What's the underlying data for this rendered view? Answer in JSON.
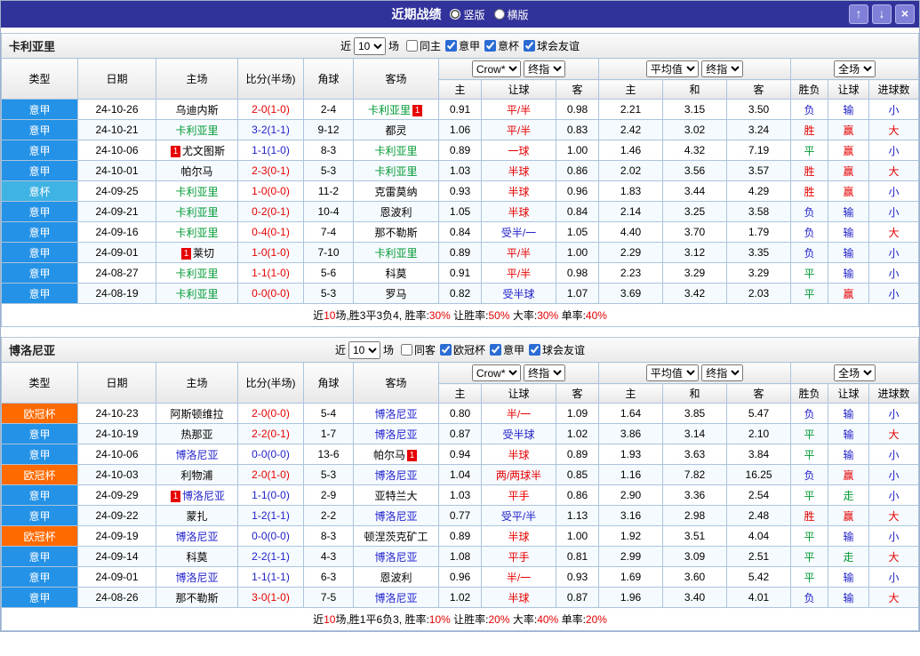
{
  "titlebar": {
    "title": "近期战绩",
    "view_options": [
      {
        "label": "竖版",
        "selected": true
      },
      {
        "label": "横版",
        "selected": false
      }
    ],
    "buttons": {
      "up": "↑",
      "down": "↓",
      "close": "×"
    }
  },
  "colors": {
    "red": "#E60000",
    "blue": "#2020C8",
    "green": "#009933",
    "black": "#000000",
    "cagliari": "#009933",
    "bologna": "#2323CC",
    "serie_a": "#2492E6",
    "coppa_italia": "#3FB3E3",
    "ucl": "#FF6A00",
    "titlebar_bg": "#32329B",
    "button_bg": "#8080D8",
    "badge_bg": "#E60000"
  },
  "table_header": {
    "base": [
      "类型",
      "日期",
      "主场",
      "比分(半场)",
      "角球",
      "客场"
    ],
    "odds_selects": [
      "Crow*",
      "终指"
    ],
    "odds_cols": [
      "主",
      "让球",
      "客"
    ],
    "avg_selects": [
      "平均值",
      "终指"
    ],
    "avg_cols": [
      "主",
      "和",
      "客"
    ],
    "full_select": "全场",
    "result_cols": [
      "胜负",
      "让球",
      "进球数"
    ]
  },
  "sections": [
    {
      "team": "卡利亚里",
      "filter": {
        "prefix": "近",
        "count": "10",
        "suffix": "场",
        "checkboxes": [
          {
            "label": "同主",
            "checked": false
          },
          {
            "label": "意甲",
            "checked": true
          },
          {
            "label": "意杯",
            "checked": true
          },
          {
            "label": "球会友谊",
            "checked": true
          }
        ]
      },
      "rows": [
        {
          "league": "意甲",
          "league_color": "serie_a",
          "date": "24-10-26",
          "home": {
            "name": "乌迪内斯",
            "color": "black"
          },
          "score": "2-0(1-0)",
          "score_color": "red",
          "corners": "2-4",
          "away": {
            "name": "卡利亚里",
            "color": "cagliari",
            "badge_after": "1"
          },
          "odds_home": "0.91",
          "handicap": "平/半",
          "handicap_color": "red",
          "odds_away": "0.98",
          "avg_home": "2.21",
          "avg_draw": "3.15",
          "avg_away": "3.50",
          "outcome": "负",
          "outcome_color": "blue",
          "handicap_result": "输",
          "handicap_result_color": "blue",
          "goals": "小",
          "goals_color": "blue"
        },
        {
          "league": "意甲",
          "league_color": "serie_a",
          "date": "24-10-21",
          "home": {
            "name": "卡利亚里",
            "color": "cagliari"
          },
          "score": "3-2(1-1)",
          "score_color": "blue",
          "corners": "9-12",
          "away": {
            "name": "都灵",
            "color": "black"
          },
          "odds_home": "1.06",
          "handicap": "平/半",
          "handicap_color": "red",
          "odds_away": "0.83",
          "avg_home": "2.42",
          "avg_draw": "3.02",
          "avg_away": "3.24",
          "outcome": "胜",
          "outcome_color": "red",
          "handicap_result": "赢",
          "handicap_result_color": "red",
          "goals": "大",
          "goals_color": "red"
        },
        {
          "league": "意甲",
          "league_color": "serie_a",
          "date": "24-10-06",
          "home": {
            "name": "尤文图斯",
            "color": "black",
            "badge_before": "1"
          },
          "score": "1-1(1-0)",
          "score_color": "blue",
          "corners": "8-3",
          "away": {
            "name": "卡利亚里",
            "color": "cagliari"
          },
          "odds_home": "0.89",
          "handicap": "一球",
          "handicap_color": "red",
          "odds_away": "1.00",
          "avg_home": "1.46",
          "avg_draw": "4.32",
          "avg_away": "7.19",
          "outcome": "平",
          "outcome_color": "green",
          "handicap_result": "赢",
          "handicap_result_color": "red",
          "goals": "小",
          "goals_color": "blue"
        },
        {
          "league": "意甲",
          "league_color": "serie_a",
          "date": "24-10-01",
          "home": {
            "name": "帕尔马",
            "color": "black"
          },
          "score": "2-3(0-1)",
          "score_color": "red",
          "corners": "5-3",
          "away": {
            "name": "卡利亚里",
            "color": "cagliari"
          },
          "odds_home": "1.03",
          "handicap": "半球",
          "handicap_color": "red",
          "odds_away": "0.86",
          "avg_home": "2.02",
          "avg_draw": "3.56",
          "avg_away": "3.57",
          "outcome": "胜",
          "outcome_color": "red",
          "handicap_result": "赢",
          "handicap_result_color": "red",
          "goals": "大",
          "goals_color": "red"
        },
        {
          "league": "意杯",
          "league_color": "coppa_italia",
          "date": "24-09-25",
          "home": {
            "name": "卡利亚里",
            "color": "cagliari"
          },
          "score": "1-0(0-0)",
          "score_color": "red",
          "corners": "11-2",
          "away": {
            "name": "克雷莫纳",
            "color": "black"
          },
          "odds_home": "0.93",
          "handicap": "半球",
          "handicap_color": "red",
          "odds_away": "0.96",
          "avg_home": "1.83",
          "avg_draw": "3.44",
          "avg_away": "4.29",
          "outcome": "胜",
          "outcome_color": "red",
          "handicap_result": "赢",
          "handicap_result_color": "red",
          "goals": "小",
          "goals_color": "blue"
        },
        {
          "league": "意甲",
          "league_color": "serie_a",
          "date": "24-09-21",
          "home": {
            "name": "卡利亚里",
            "color": "cagliari"
          },
          "score": "0-2(0-1)",
          "score_color": "red",
          "corners": "10-4",
          "away": {
            "name": "恩波利",
            "color": "black"
          },
          "odds_home": "1.05",
          "handicap": "半球",
          "handicap_color": "red",
          "odds_away": "0.84",
          "avg_home": "2.14",
          "avg_draw": "3.25",
          "avg_away": "3.58",
          "outcome": "负",
          "outcome_color": "blue",
          "handicap_result": "输",
          "handicap_result_color": "blue",
          "goals": "小",
          "goals_color": "blue"
        },
        {
          "league": "意甲",
          "league_color": "serie_a",
          "date": "24-09-16",
          "home": {
            "name": "卡利亚里",
            "color": "cagliari"
          },
          "score": "0-4(0-1)",
          "score_color": "red",
          "corners": "7-4",
          "away": {
            "name": "那不勒斯",
            "color": "black"
          },
          "odds_home": "0.84",
          "handicap": "受半/一",
          "handicap_color": "blue",
          "odds_away": "1.05",
          "avg_home": "4.40",
          "avg_draw": "3.70",
          "avg_away": "1.79",
          "outcome": "负",
          "outcome_color": "blue",
          "handicap_result": "输",
          "handicap_result_color": "blue",
          "goals": "大",
          "goals_color": "red"
        },
        {
          "league": "意甲",
          "league_color": "serie_a",
          "date": "24-09-01",
          "home": {
            "name": "莱切",
            "color": "black",
            "badge_before": "1"
          },
          "score": "1-0(1-0)",
          "score_color": "red",
          "corners": "7-10",
          "away": {
            "name": "卡利亚里",
            "color": "cagliari"
          },
          "odds_home": "0.89",
          "handicap": "平/半",
          "handicap_color": "red",
          "odds_away": "1.00",
          "avg_home": "2.29",
          "avg_draw": "3.12",
          "avg_away": "3.35",
          "outcome": "负",
          "outcome_color": "blue",
          "handicap_result": "输",
          "handicap_result_color": "blue",
          "goals": "小",
          "goals_color": "blue"
        },
        {
          "league": "意甲",
          "league_color": "serie_a",
          "date": "24-08-27",
          "home": {
            "name": "卡利亚里",
            "color": "cagliari"
          },
          "score": "1-1(1-0)",
          "score_color": "red",
          "corners": "5-6",
          "away": {
            "name": "科莫",
            "color": "black"
          },
          "odds_home": "0.91",
          "handicap": "平/半",
          "handicap_color": "red",
          "odds_away": "0.98",
          "avg_home": "2.23",
          "avg_draw": "3.29",
          "avg_away": "3.29",
          "outcome": "平",
          "outcome_color": "green",
          "handicap_result": "输",
          "handicap_result_color": "blue",
          "goals": "小",
          "goals_color": "blue"
        },
        {
          "league": "意甲",
          "league_color": "serie_a",
          "date": "24-08-19",
          "home": {
            "name": "卡利亚里",
            "color": "cagliari"
          },
          "score": "0-0(0-0)",
          "score_color": "red",
          "corners": "5-3",
          "away": {
            "name": "罗马",
            "color": "black"
          },
          "odds_home": "0.82",
          "handicap": "受半球",
          "handicap_color": "blue",
          "odds_away": "1.07",
          "avg_home": "3.69",
          "avg_draw": "3.42",
          "avg_away": "2.03",
          "outcome": "平",
          "outcome_color": "green",
          "handicap_result": "赢",
          "handicap_result_color": "red",
          "goals": "小",
          "goals_color": "blue"
        }
      ],
      "summary": [
        {
          "text": "近",
          "red": false
        },
        {
          "text": "10",
          "red": true
        },
        {
          "text": "场,胜3平3负4, 胜率:",
          "red": false
        },
        {
          "text": "30%",
          "red": true
        },
        {
          "text": " 让胜率:",
          "red": false
        },
        {
          "text": "50%",
          "red": true
        },
        {
          "text": " 大率:",
          "red": false
        },
        {
          "text": "30%",
          "red": true
        },
        {
          "text": " 单率:",
          "red": false
        },
        {
          "text": "40%",
          "red": true
        }
      ]
    },
    {
      "team": "博洛尼亚",
      "filter": {
        "prefix": "近",
        "count": "10",
        "suffix": "场",
        "checkboxes": [
          {
            "label": "同客",
            "checked": false
          },
          {
            "label": "欧冠杯",
            "checked": true
          },
          {
            "label": "意甲",
            "checked": true
          },
          {
            "label": "球会友谊",
            "checked": true
          }
        ]
      },
      "rows": [
        {
          "league": "欧冠杯",
          "league_color": "ucl",
          "date": "24-10-23",
          "home": {
            "name": "阿斯顿维拉",
            "color": "black"
          },
          "score": "2-0(0-0)",
          "score_color": "red",
          "corners": "5-4",
          "away": {
            "name": "博洛尼亚",
            "color": "bologna"
          },
          "odds_home": "0.80",
          "handicap": "半/一",
          "handicap_color": "red",
          "odds_away": "1.09",
          "avg_home": "1.64",
          "avg_draw": "3.85",
          "avg_away": "5.47",
          "outcome": "负",
          "outcome_color": "blue",
          "handicap_result": "输",
          "handicap_result_color": "blue",
          "goals": "小",
          "goals_color": "blue"
        },
        {
          "league": "意甲",
          "league_color": "serie_a",
          "date": "24-10-19",
          "home": {
            "name": "热那亚",
            "color": "black"
          },
          "score": "2-2(0-1)",
          "score_color": "red",
          "corners": "1-7",
          "away": {
            "name": "博洛尼亚",
            "color": "bologna"
          },
          "odds_home": "0.87",
          "handicap": "受半球",
          "handicap_color": "blue",
          "odds_away": "1.02",
          "avg_home": "3.86",
          "avg_draw": "3.14",
          "avg_away": "2.10",
          "outcome": "平",
          "outcome_color": "green",
          "handicap_result": "输",
          "handicap_result_color": "blue",
          "goals": "大",
          "goals_color": "red"
        },
        {
          "league": "意甲",
          "league_color": "serie_a",
          "date": "24-10-06",
          "home": {
            "name": "博洛尼亚",
            "color": "bologna"
          },
          "score": "0-0(0-0)",
          "score_color": "blue",
          "corners": "13-6",
          "away": {
            "name": "帕尔马",
            "color": "black",
            "badge_after": "1"
          },
          "odds_home": "0.94",
          "handicap": "半球",
          "handicap_color": "red",
          "odds_away": "0.89",
          "avg_home": "1.93",
          "avg_draw": "3.63",
          "avg_away": "3.84",
          "outcome": "平",
          "outcome_color": "green",
          "handicap_result": "输",
          "handicap_result_color": "blue",
          "goals": "小",
          "goals_color": "blue"
        },
        {
          "league": "欧冠杯",
          "league_color": "ucl",
          "date": "24-10-03",
          "home": {
            "name": "利物浦",
            "color": "black"
          },
          "score": "2-0(1-0)",
          "score_color": "red",
          "corners": "5-3",
          "away": {
            "name": "博洛尼亚",
            "color": "bologna"
          },
          "odds_home": "1.04",
          "handicap": "两/两球半",
          "handicap_color": "red",
          "odds_away": "0.85",
          "avg_home": "1.16",
          "avg_draw": "7.82",
          "avg_away": "16.25",
          "outcome": "负",
          "outcome_color": "blue",
          "handicap_result": "赢",
          "handicap_result_color": "red",
          "goals": "小",
          "goals_color": "blue"
        },
        {
          "league": "意甲",
          "league_color": "serie_a",
          "date": "24-09-29",
          "home": {
            "name": "博洛尼亚",
            "color": "bologna",
            "badge_before": "1"
          },
          "score": "1-1(0-0)",
          "score_color": "blue",
          "corners": "2-9",
          "away": {
            "name": "亚特兰大",
            "color": "black"
          },
          "odds_home": "1.03",
          "handicap": "平手",
          "handicap_color": "red",
          "odds_away": "0.86",
          "avg_home": "2.90",
          "avg_draw": "3.36",
          "avg_away": "2.54",
          "outcome": "平",
          "outcome_color": "green",
          "handicap_result": "走",
          "handicap_result_color": "green",
          "goals": "小",
          "goals_color": "blue"
        },
        {
          "league": "意甲",
          "league_color": "serie_a",
          "date": "24-09-22",
          "home": {
            "name": "蒙扎",
            "color": "black"
          },
          "score": "1-2(1-1)",
          "score_color": "blue",
          "corners": "2-2",
          "away": {
            "name": "博洛尼亚",
            "color": "bologna"
          },
          "odds_home": "0.77",
          "handicap": "受平/半",
          "handicap_color": "blue",
          "odds_away": "1.13",
          "avg_home": "3.16",
          "avg_draw": "2.98",
          "avg_away": "2.48",
          "outcome": "胜",
          "outcome_color": "red",
          "handicap_result": "赢",
          "handicap_result_color": "red",
          "goals": "大",
          "goals_color": "red"
        },
        {
          "league": "欧冠杯",
          "league_color": "ucl",
          "date": "24-09-19",
          "home": {
            "name": "博洛尼亚",
            "color": "bologna"
          },
          "score": "0-0(0-0)",
          "score_color": "blue",
          "corners": "8-3",
          "away": {
            "name": "顿涅茨克矿工",
            "color": "black"
          },
          "odds_home": "0.89",
          "handicap": "半球",
          "handicap_color": "red",
          "odds_away": "1.00",
          "avg_home": "1.92",
          "avg_draw": "3.51",
          "avg_away": "4.04",
          "outcome": "平",
          "outcome_color": "green",
          "handicap_result": "输",
          "handicap_result_color": "blue",
          "goals": "小",
          "goals_color": "blue"
        },
        {
          "league": "意甲",
          "league_color": "serie_a",
          "date": "24-09-14",
          "home": {
            "name": "科莫",
            "color": "black"
          },
          "score": "2-2(1-1)",
          "score_color": "blue",
          "corners": "4-3",
          "away": {
            "name": "博洛尼亚",
            "color": "bologna"
          },
          "odds_home": "1.08",
          "handicap": "平手",
          "handicap_color": "red",
          "odds_away": "0.81",
          "avg_home": "2.99",
          "avg_draw": "3.09",
          "avg_away": "2.51",
          "outcome": "平",
          "outcome_color": "green",
          "handicap_result": "走",
          "handicap_result_color": "green",
          "goals": "大",
          "goals_color": "red"
        },
        {
          "league": "意甲",
          "league_color": "serie_a",
          "date": "24-09-01",
          "home": {
            "name": "博洛尼亚",
            "color": "bologna"
          },
          "score": "1-1(1-1)",
          "score_color": "blue",
          "corners": "6-3",
          "away": {
            "name": "恩波利",
            "color": "black"
          },
          "odds_home": "0.96",
          "handicap": "半/一",
          "handicap_color": "red",
          "odds_away": "0.93",
          "avg_home": "1.69",
          "avg_draw": "3.60",
          "avg_away": "5.42",
          "outcome": "平",
          "outcome_color": "green",
          "handicap_result": "输",
          "handicap_result_color": "blue",
          "goals": "小",
          "goals_color": "blue"
        },
        {
          "league": "意甲",
          "league_color": "serie_a",
          "date": "24-08-26",
          "home": {
            "name": "那不勒斯",
            "color": "black"
          },
          "score": "3-0(1-0)",
          "score_color": "red",
          "corners": "7-5",
          "away": {
            "name": "博洛尼亚",
            "color": "bologna"
          },
          "odds_home": "1.02",
          "handicap": "半球",
          "handicap_color": "red",
          "odds_away": "0.87",
          "avg_home": "1.96",
          "avg_draw": "3.40",
          "avg_away": "4.01",
          "outcome": "负",
          "outcome_color": "blue",
          "handicap_result": "输",
          "handicap_result_color": "blue",
          "goals": "大",
          "goals_color": "red"
        }
      ],
      "summary": [
        {
          "text": "近",
          "red": false
        },
        {
          "text": "10",
          "red": true
        },
        {
          "text": "场,胜1平6负3, 胜率:",
          "red": false
        },
        {
          "text": "10%",
          "red": true
        },
        {
          "text": " 让胜率:",
          "red": false
        },
        {
          "text": "20%",
          "red": true
        },
        {
          "text": " 大率:",
          "red": false
        },
        {
          "text": "40%",
          "red": true
        },
        {
          "text": " 单率:",
          "red": false
        },
        {
          "text": "20%",
          "red": true
        }
      ]
    }
  ]
}
